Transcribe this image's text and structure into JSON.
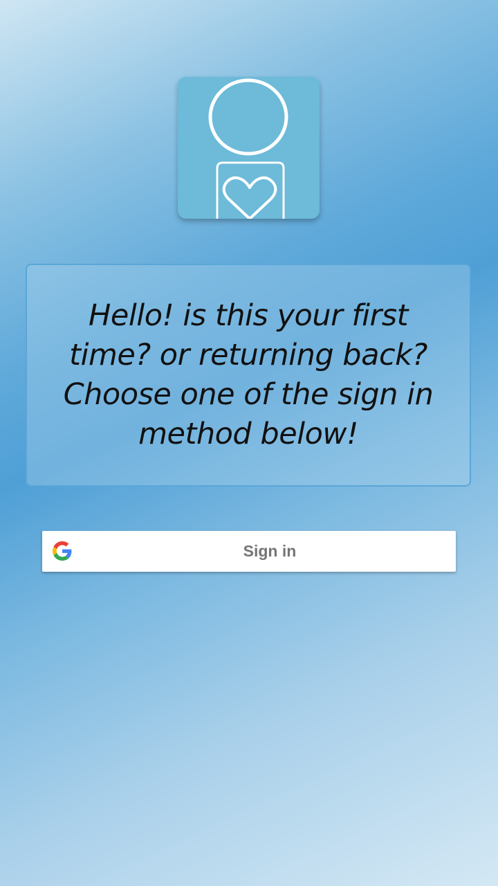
{
  "app": {
    "logo_icon": "person-heart-icon",
    "logo_background": "#6dbad9"
  },
  "message": {
    "text": "Hello! is this your first time? or returning back?  Choose one of the sign in method below!"
  },
  "signin_button": {
    "label": "Sign in",
    "provider_icon": "google-g-icon"
  },
  "colors": {
    "background_gradient": [
      "#cfe6f3",
      "#4f9fd6",
      "#d4e8f4"
    ],
    "card_border": "#5aa6d8",
    "button_text": "#757575"
  }
}
